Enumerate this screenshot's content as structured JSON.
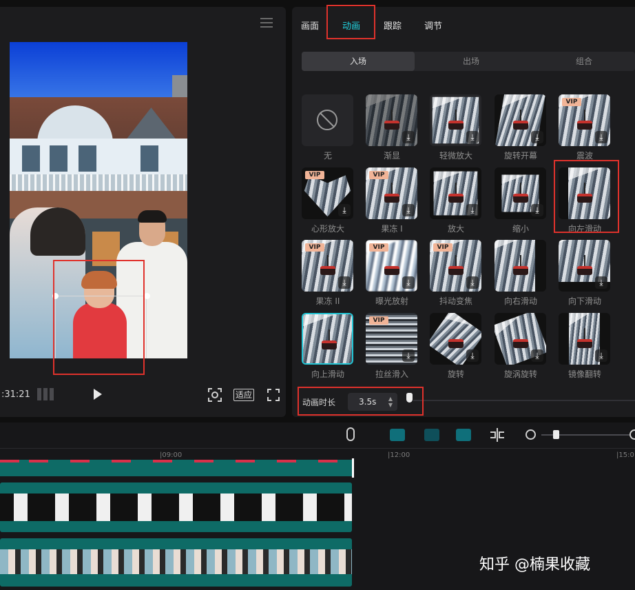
{
  "preview": {
    "time": ":31:21",
    "fit_label": "适应"
  },
  "main_tabs": [
    {
      "label": "画面"
    },
    {
      "label": "动画"
    },
    {
      "label": "跟踪"
    },
    {
      "label": "调节"
    }
  ],
  "sub_tabs": [
    {
      "label": "入场"
    },
    {
      "label": "出场"
    },
    {
      "label": "组合"
    }
  ],
  "animations": [
    {
      "label": "无"
    },
    {
      "label": "渐显"
    },
    {
      "label": "轻微放大"
    },
    {
      "label": "旋转开幕"
    },
    {
      "label": "震波",
      "vip": "VIP"
    },
    {
      "label": "心形放大",
      "vip": "VIP"
    },
    {
      "label": "果冻 I",
      "vip": "VIP"
    },
    {
      "label": "放大"
    },
    {
      "label": "缩小"
    },
    {
      "label": "向左滑动"
    },
    {
      "label": "果冻 II",
      "vip": "VIP"
    },
    {
      "label": "曝光放射",
      "vip": "VIP"
    },
    {
      "label": "抖动变焦",
      "vip": "VIP"
    },
    {
      "label": "向右滑动"
    },
    {
      "label": "向下滑动"
    },
    {
      "label": "向上滑动"
    },
    {
      "label": "拉丝滑入",
      "vip": "VIP"
    },
    {
      "label": "旋转"
    },
    {
      "label": "旋涡旋转"
    },
    {
      "label": "镜像翻转"
    }
  ],
  "duration": {
    "label": "动画时长",
    "value": "3.5s"
  },
  "timeline": {
    "ruler": [
      "|09:00",
      "|12:00",
      "|15:0"
    ]
  },
  "watermark": "知乎 @楠果收藏",
  "colors": {
    "accent": "#22d3e0",
    "highlight_box": "#e0322c",
    "track": "#0e6b66"
  }
}
